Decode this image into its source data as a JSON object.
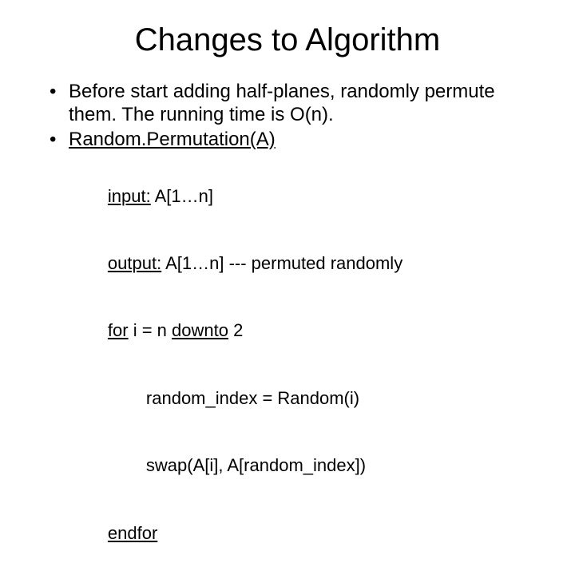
{
  "title": "Changes to Algorithm",
  "bullets": {
    "b1": "Before start adding half-planes, randomly permute them. The running time is O(n).",
    "b2_prefix": "Random.Permutation(A)"
  },
  "code": {
    "l1a": "input:",
    "l1b": " A[1…n]",
    "l2a": "output:",
    "l2b": " A[1…n] --- permuted randomly",
    "l3a": "for",
    "l3b": " i = n ",
    "l3c": "downto",
    "l3d": " 2",
    "l4": "random_index = Random(i)",
    "l5": "swap(A[i], A[random_index])",
    "l6": "endfor"
  }
}
